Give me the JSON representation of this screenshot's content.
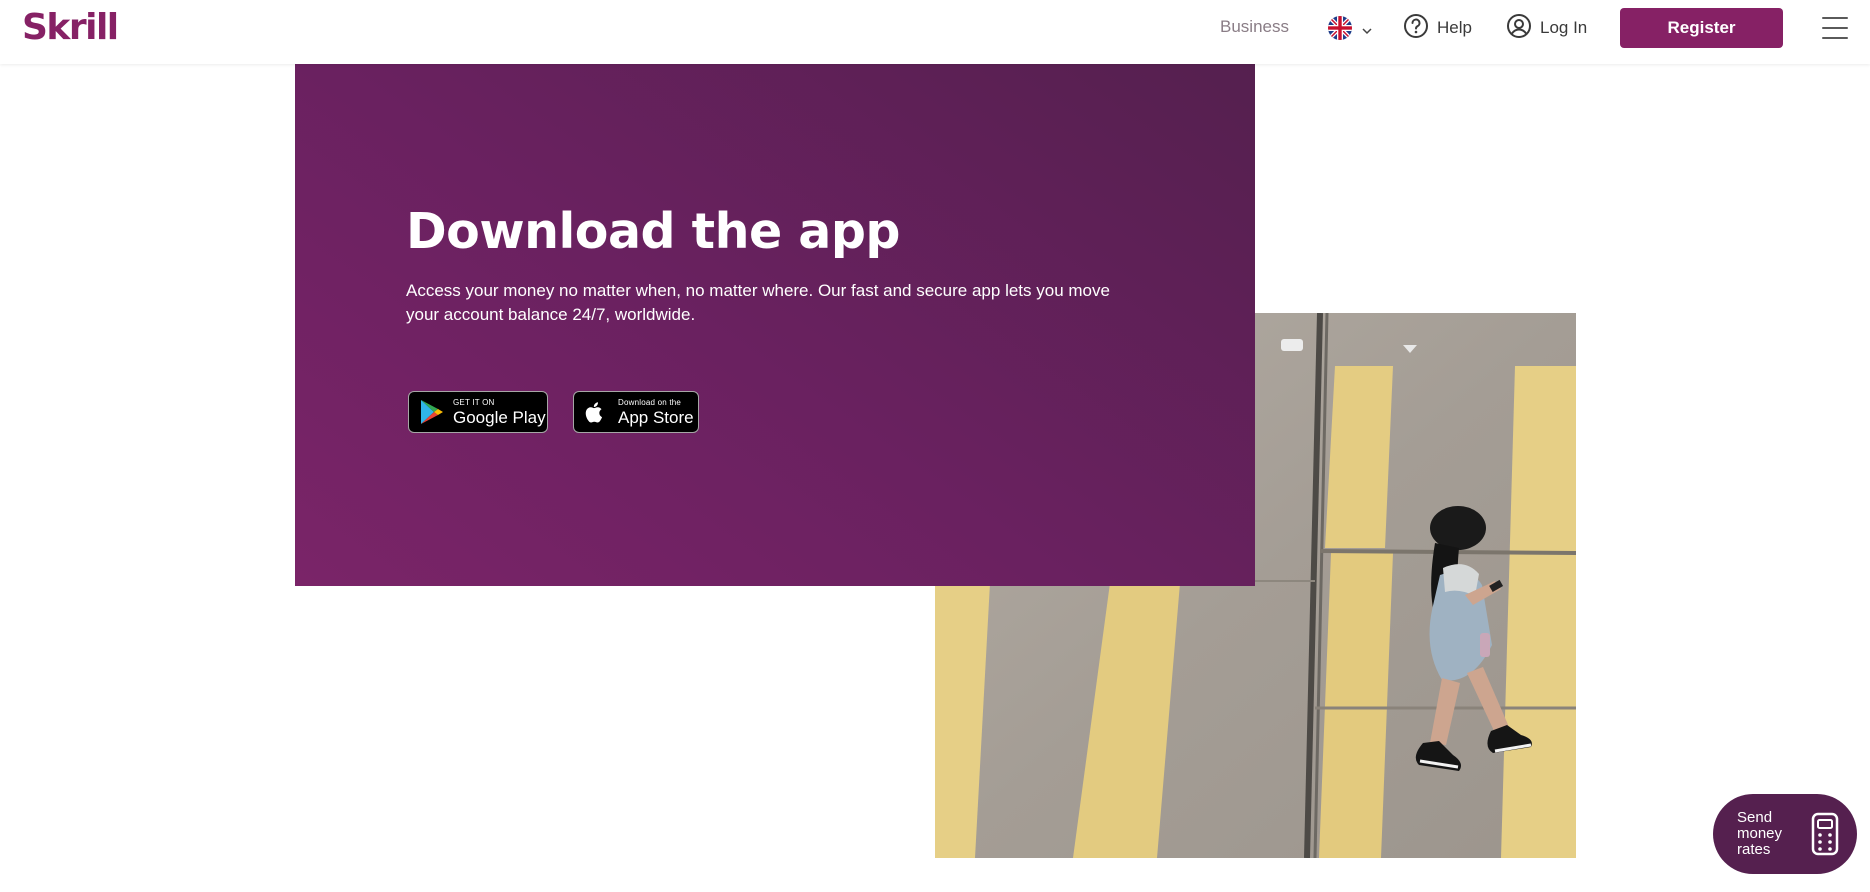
{
  "header": {
    "logo_text": "Skrill",
    "business_label": "Business",
    "language_icon": "uk-flag-icon",
    "help_label": "Help",
    "login_label": "Log In",
    "register_label": "Register"
  },
  "hero": {
    "title": "Download the app",
    "description": "Access your money no matter when, no matter where. Our fast and secure app lets you move your account balance 24/7, worldwide.",
    "google_play": {
      "small": "GET IT ON",
      "big": "Google Play"
    },
    "app_store": {
      "small": "Download on the",
      "big": "App Store"
    }
  },
  "rates_button": {
    "label": "Send money rates"
  },
  "colors": {
    "brand": "#862165",
    "brand_dark": "#55204f"
  }
}
